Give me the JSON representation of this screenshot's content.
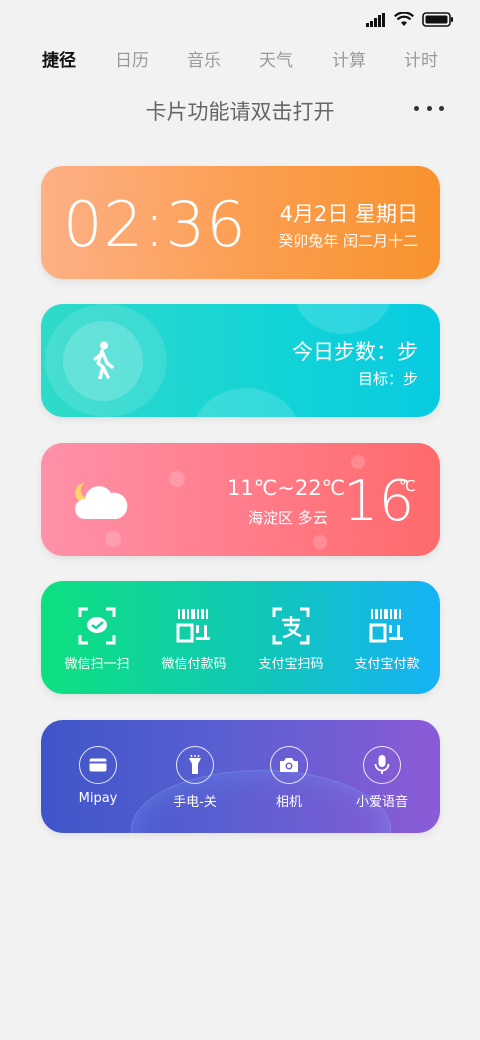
{
  "tabs": [
    "捷径",
    "日历",
    "音乐",
    "天气",
    "计算",
    "计时"
  ],
  "hint": "卡片功能请双击打开",
  "clock": {
    "time": "02:36",
    "date": "4月2日 星期日",
    "lunar": "癸卯兔年 闰二月十二"
  },
  "steps": {
    "title": "今日步数：步",
    "goal": "目标：步"
  },
  "weather": {
    "range": "11℃~22℃",
    "location": "海淀区 多云",
    "temp": "16",
    "unit": "℃"
  },
  "pay": {
    "items": [
      {
        "label": "微信扫一扫",
        "icon": "wechat-scan-icon"
      },
      {
        "label": "微信付款码",
        "icon": "barcode-icon"
      },
      {
        "label": "支付宝扫码",
        "icon": "alipay-scan-icon"
      },
      {
        "label": "支付宝付款",
        "icon": "barcode-icon"
      }
    ]
  },
  "tools": {
    "items": [
      {
        "label": "Mipay",
        "icon": "card-icon"
      },
      {
        "label": "手电-关",
        "icon": "flashlight-icon"
      },
      {
        "label": "相机",
        "icon": "camera-icon"
      },
      {
        "label": "小爱语音",
        "icon": "microphone-icon"
      }
    ]
  },
  "colors": {
    "clock_card": "#fb9d4d",
    "steps_card": "#12d3d6",
    "weather_card": "#ff7d8c",
    "pay_card": "#10c7b8",
    "tools_card": "#5a5fd2"
  }
}
